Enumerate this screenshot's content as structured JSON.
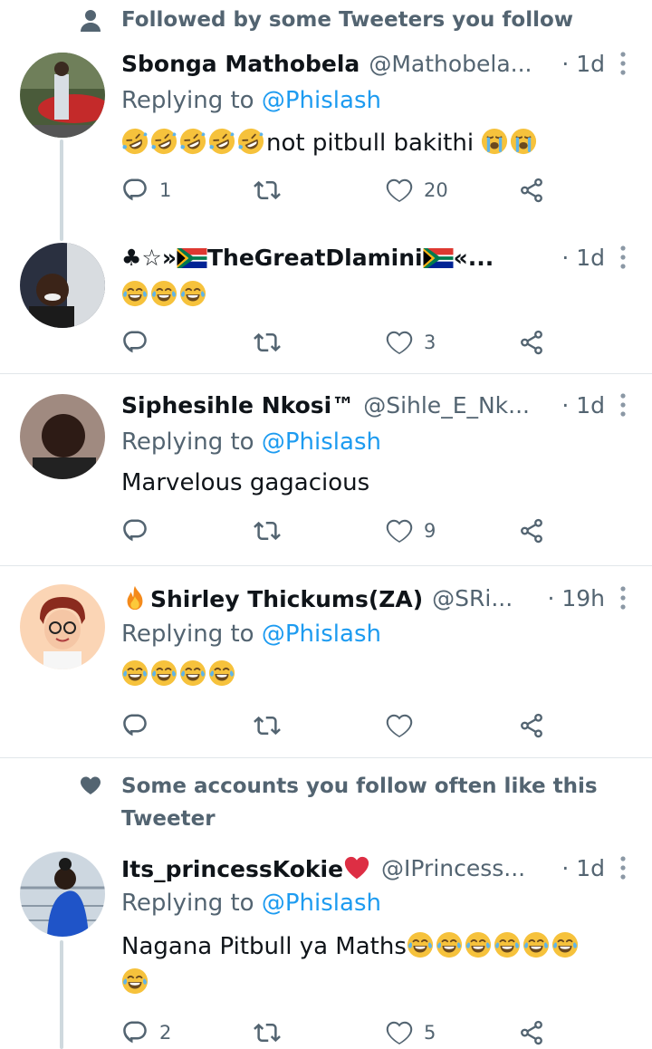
{
  "context_followed": {
    "text": "Followed by some Tweeters you follow",
    "icon": "person-icon"
  },
  "context_liked": {
    "text": "Some accounts you follow often like this Tweeter",
    "icon": "heart-filled-icon"
  },
  "colors": {
    "mention": "#1d9bf0",
    "muted": "#536471",
    "text": "#0f1419",
    "divider": "#e1e6ea",
    "thread": "#cfd9de"
  },
  "tweets": [
    {
      "name": "Sbonga Mathobela",
      "handle": "@Mathobela...",
      "time": "· 1d",
      "replying_prefix": "Replying to ",
      "replying_to": "@Phislash",
      "text": "not pitbull bakithi",
      "reply_count": "1",
      "retweet_count": "",
      "like_count": "20"
    },
    {
      "name_prefix": "♣☆»",
      "name": "TheGreatDlamini",
      "name_suffix": "«...",
      "handle": "",
      "time": "· 1d",
      "text": "",
      "reply_count": "",
      "retweet_count": "",
      "like_count": "3"
    },
    {
      "name": "Siphesihle Nkosi™",
      "handle": "@Sihle_E_Nk...",
      "time": "· 1d",
      "replying_prefix": "Replying to ",
      "replying_to": "@Phislash",
      "text": "Marvelous gagacious",
      "reply_count": "",
      "retweet_count": "",
      "like_count": "9"
    },
    {
      "name": "Shirley Thickums(ZA)",
      "handle": "@SRi...",
      "time": "· 19h",
      "replying_prefix": "Replying to ",
      "replying_to": "@Phislash",
      "text": "",
      "reply_count": "",
      "retweet_count": "",
      "like_count": ""
    },
    {
      "name": "Its_princessKokie",
      "handle": "@IPrincess...",
      "time": "· 1d",
      "replying_prefix": "Replying to ",
      "replying_to": "@Phislash",
      "text": "Nagana Pitbull ya Maths",
      "reply_count": "2",
      "retweet_count": "",
      "like_count": "5"
    }
  ]
}
